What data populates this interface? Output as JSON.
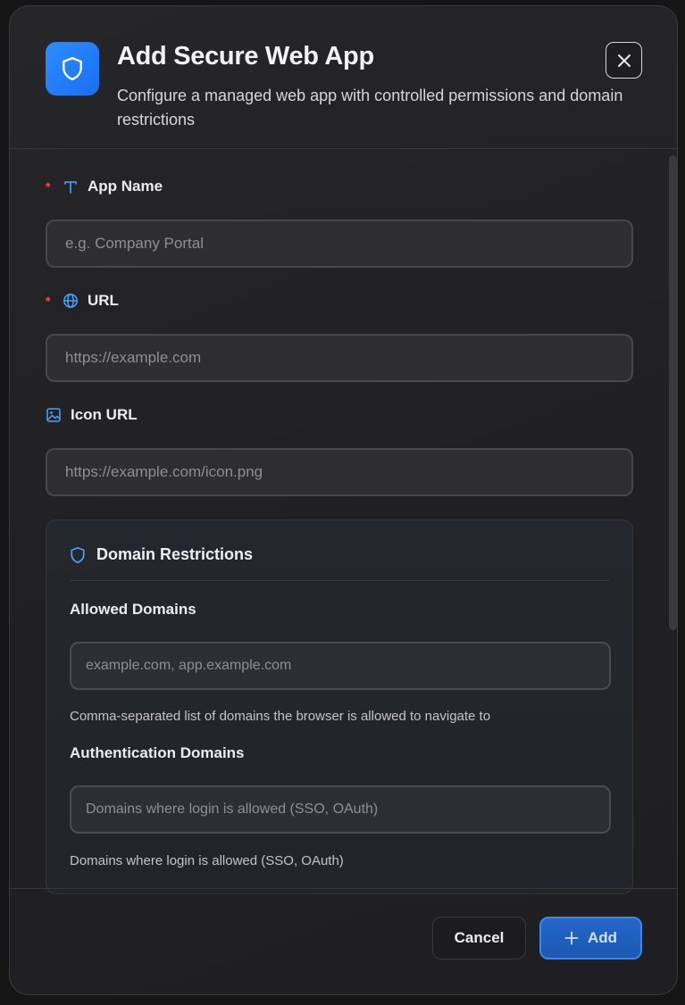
{
  "header": {
    "title": "Add Secure Web App",
    "subtitle": "Configure a managed web app with controlled permissions and domain restrictions"
  },
  "fields": {
    "app_name": {
      "required_mark": "*",
      "label": "App Name",
      "placeholder": "e.g. Company Portal",
      "icon": "text-icon"
    },
    "url": {
      "required_mark": "*",
      "label": "URL",
      "placeholder": "https://example.com",
      "icon": "globe-icon"
    },
    "icon_url": {
      "label": "Icon URL",
      "placeholder": "https://example.com/icon.png",
      "icon": "image-icon"
    }
  },
  "domain_restrictions": {
    "title": "Domain Restrictions",
    "icon": "shield-icon",
    "allowed": {
      "label": "Allowed Domains",
      "placeholder": "example.com, app.example.com",
      "hint": "Comma-separated list of domains the browser is allowed to navigate to"
    },
    "auth": {
      "label": "Authentication Domains",
      "placeholder": "Domains where login is allowed (SSO, OAuth)",
      "hint": "Domains where login is allowed (SSO, OAuth)"
    }
  },
  "footer": {
    "cancel_label": "Cancel",
    "add_label": "Add"
  },
  "colors": {
    "accent": "#2d8cff",
    "required": "#ff4a4a",
    "icon_blue": "#4aa3ff"
  }
}
